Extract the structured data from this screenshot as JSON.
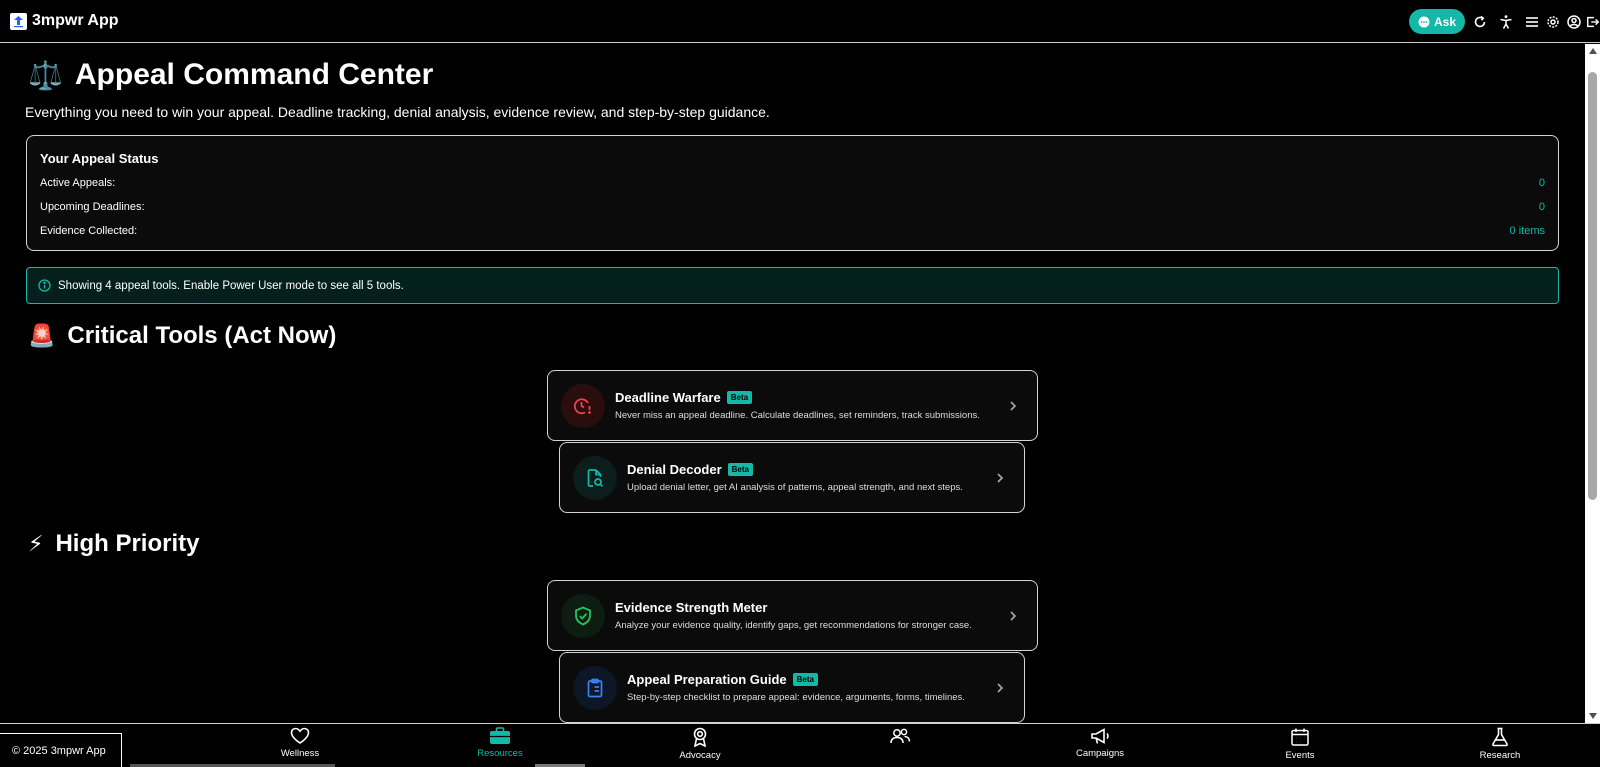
{
  "header": {
    "app_title": "3mpwr App",
    "ask_label": "Ask"
  },
  "page": {
    "title_emoji": "⚖️",
    "title": "Appeal Command Center",
    "subtitle": "Everything you need to win your appeal. Deadline tracking, denial analysis, evidence review, and step-by-step guidance."
  },
  "status": {
    "title": "Your Appeal Status",
    "rows": [
      {
        "label": "Active Appeals:",
        "value": "0"
      },
      {
        "label": "Upcoming Deadlines:",
        "value": "0"
      },
      {
        "label": "Evidence Collected:",
        "value": "0 items"
      }
    ]
  },
  "info_banner": "Showing 4 appeal tools. Enable Power User mode to see all 5 tools.",
  "sections": {
    "critical": {
      "emoji": "🚨",
      "title": "Critical Tools (Act Now)"
    },
    "high": {
      "emoji": "⚡",
      "title": "High Priority"
    }
  },
  "tools": [
    {
      "name": "Deadline Warfare",
      "badge": "Beta",
      "desc": "Never miss an appeal deadline. Calculate deadlines, set reminders, track submissions.",
      "icon": "clock-alert-icon",
      "color": "#ef4444"
    },
    {
      "name": "Denial Decoder",
      "badge": "Beta",
      "desc": "Upload denial letter, get AI analysis of patterns, appeal strength, and next steps.",
      "icon": "file-search-icon",
      "color": "#14b8a6"
    },
    {
      "name": "Evidence Strength Meter",
      "badge": "",
      "desc": "Analyze your evidence quality, identify gaps, get recommendations for stronger case.",
      "icon": "shield-check-icon",
      "color": "#22c55e"
    },
    {
      "name": "Appeal Preparation Guide",
      "badge": "Beta",
      "desc": "Step-by-step checklist to prepare appeal: evidence, arguments, forms, timelines.",
      "icon": "clipboard-list-icon",
      "color": "#3b82f6"
    }
  ],
  "footer": {
    "copyright": "© 2025 3mpwr App"
  },
  "nav": [
    {
      "label": "Wellness",
      "icon": "heart-icon"
    },
    {
      "label": "Resources",
      "icon": "briefcase-icon",
      "active": true
    },
    {
      "label": "Advocacy",
      "icon": "award-icon"
    },
    {
      "label": "",
      "icon": "users-icon"
    },
    {
      "label": "Campaigns",
      "icon": "megaphone-icon"
    },
    {
      "label": "Events",
      "icon": "calendar-icon"
    },
    {
      "label": "Research",
      "icon": "flask-icon"
    }
  ],
  "colors": {
    "accent": "#14b8a6"
  }
}
